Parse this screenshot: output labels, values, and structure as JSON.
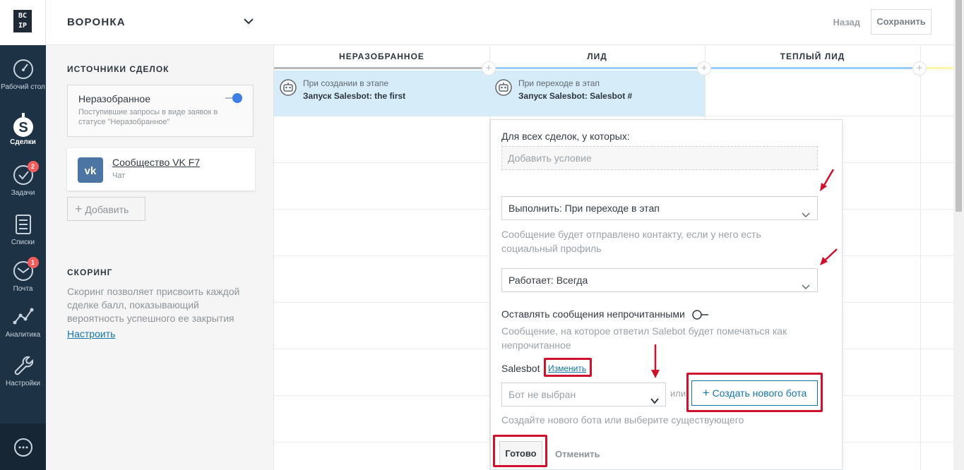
{
  "nav": {
    "logo_line1": "BC",
    "logo_line2": "IP",
    "items": [
      {
        "label": "Рабочий стол",
        "icon": "dashboard-icon"
      },
      {
        "label": "Сделки",
        "icon": "dollar-icon"
      },
      {
        "label": "Задачи",
        "icon": "check-icon",
        "badge": "2"
      },
      {
        "label": "Списки",
        "icon": "list-icon"
      },
      {
        "label": "Почта",
        "icon": "mail-icon",
        "badge": "1"
      },
      {
        "label": "Аналитика",
        "icon": "analytics-icon"
      },
      {
        "label": "Настройки",
        "icon": "wrench-icon"
      }
    ],
    "chat_icon": "chat-icon"
  },
  "panel": {
    "title": "ВОРОНКА",
    "sources_title": "ИСТОЧНИКИ СДЕЛОК",
    "source_card": {
      "title": "Неразобранное",
      "description": "Поступившие запросы в виде заявок в статусе \"Неразобранное\""
    },
    "vk": {
      "name": "Сообщество VK F7",
      "sub": "Чат"
    },
    "add_label": "Добавить",
    "scoring_title": "СКОРИНГ",
    "scoring_desc": "Скоринг позволяет присвоить каждой сделке балл, показывающий вероятность успешного ее закрытия",
    "scoring_link": "Настроить"
  },
  "header": {
    "back": "Назад",
    "save": "Сохранить"
  },
  "columns": [
    {
      "title": "НЕРАЗОБРАННОЕ",
      "color": "#b5b9bd"
    },
    {
      "title": "ЛИД",
      "color": "#99ccff"
    },
    {
      "title": "ТЕПЛЫЙ ЛИД",
      "color": "#99ccff"
    },
    {
      "title": "",
      "color": "#fff7a5"
    }
  ],
  "triggers": [
    {
      "line1": "При создании в этапе",
      "line2": "Запуск Salesbot: the first"
    },
    {
      "line1": "При переходе в этап",
      "line2": "Запуск Salesbot: Salesbot #"
    }
  ],
  "popup": {
    "for_all": "Для всех сделок, у которых:",
    "add_condition": "Добавить условие",
    "execute": "Выполнить: При переходе в этап",
    "execute_note": "Сообщение будет отправлено контакту, если у него есть социальный профиль",
    "works": "Работает: Всегда",
    "unread_label": "Оставлять сообщения непрочитанными",
    "unread_note": "Сообщение, на которое ответил Salebot будет помечаться как непрочитанное",
    "salesbot_label": "Salesbot",
    "edit_link": "Изменить",
    "bot_select": "Бот не выбран",
    "or": "или",
    "create_bot": "Создать нового бота",
    "create_hint": "Создайте нового бота или выберите существующего",
    "done": "Готово",
    "cancel": "Отменить"
  },
  "colors": {
    "nav_bg": "#1e3246",
    "accent": "#1375ab",
    "highlight": "#d0112b",
    "trigger_bg": "#d7ecf9"
  }
}
